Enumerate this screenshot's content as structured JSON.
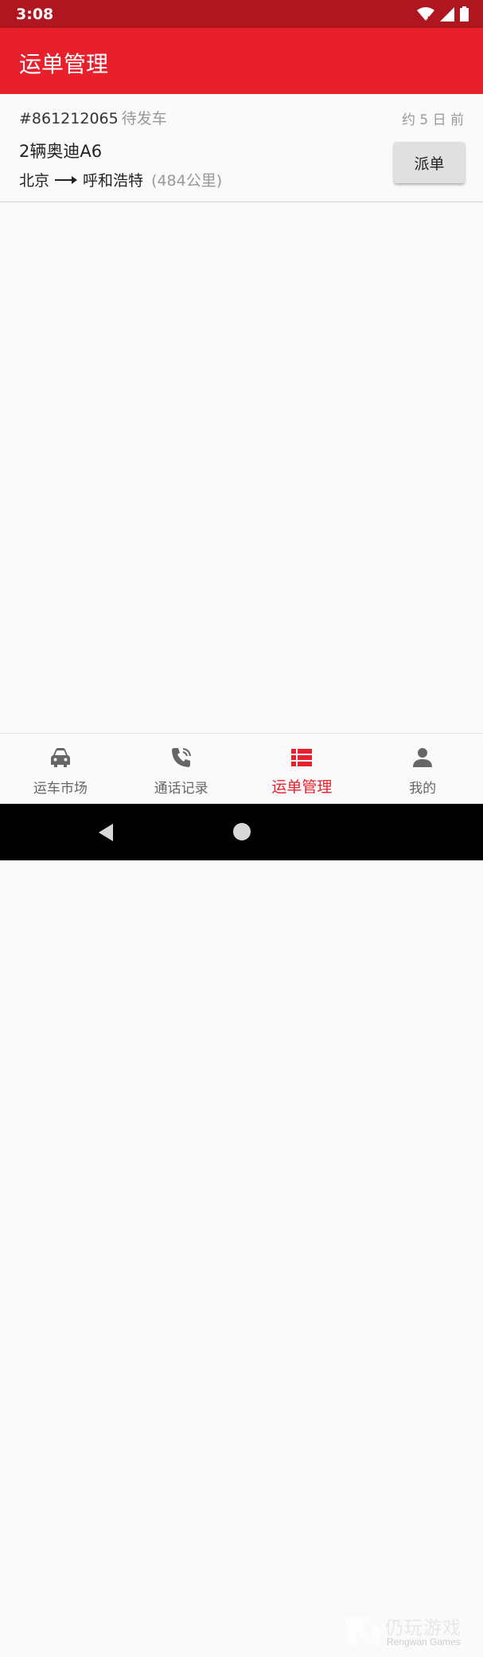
{
  "status_bar": {
    "time": "3:08"
  },
  "app_bar": {
    "title": "运单管理"
  },
  "order": {
    "id": "#861212065",
    "status": "待发车",
    "time_ago": "约 5 日 前",
    "vehicle": "2辆奥迪A6",
    "origin": "北京",
    "destination": "呼和浩特",
    "distance": "(484公里)",
    "dispatch_label": "派单"
  },
  "bottom_nav": {
    "items": [
      {
        "label": "运车市场",
        "icon": "car-icon"
      },
      {
        "label": "通话记录",
        "icon": "phone-call-icon"
      },
      {
        "label": "运单管理",
        "icon": "list-icon",
        "active": true
      },
      {
        "label": "我的",
        "icon": "person-icon"
      }
    ]
  },
  "watermark": {
    "title": "仍玩游戏",
    "subtitle": "Rengwan Games"
  },
  "colors": {
    "primary": "#e8202c",
    "status_bar": "#b0161f",
    "inactive": "#666666"
  }
}
